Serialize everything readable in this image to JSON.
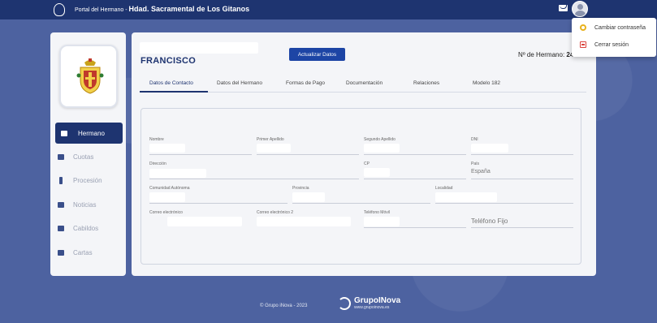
{
  "header": {
    "title_prefix": "Portal del Hermano - ",
    "title_main": "Hdad. Sacramental de Los Gitanos"
  },
  "user_menu": {
    "items": [
      {
        "label": "Cambiar contraseña",
        "icon": "gear-icon"
      },
      {
        "label": "Cerrar sesión",
        "icon": "logout-icon"
      }
    ]
  },
  "sidebar": {
    "items": [
      {
        "label": "Hermano",
        "icon": "person-icon",
        "active": true
      },
      {
        "label": "Cuotas",
        "icon": "coins-icon"
      },
      {
        "label": "Procesión",
        "icon": "cross-icon"
      },
      {
        "label": "Noticias",
        "icon": "newspaper-icon"
      },
      {
        "label": "Cabildos",
        "icon": "people-icon"
      },
      {
        "label": "Cartas",
        "icon": "letter-icon"
      }
    ]
  },
  "profile": {
    "name": "FRANCISCO",
    "update_button": "Actualizar Datos",
    "member_number_label": "Nº de Hermano:",
    "member_number_value": "24"
  },
  "tabs": [
    {
      "label": "Datos de Contacto",
      "active": true
    },
    {
      "label": "Datos del Hermano"
    },
    {
      "label": "Formas de Pago"
    },
    {
      "label": "Documentación"
    },
    {
      "label": "Relaciones"
    },
    {
      "label": "Modelo 182"
    }
  ],
  "form": {
    "nombre": "Nombre",
    "primer_apellido": "Primer Apellido",
    "segundo_apellido": "Segundo Apellido",
    "dni": "DNI",
    "direccion": "Dirección",
    "cp": "CP",
    "pais": "País",
    "pais_value": "España",
    "comunidad": "Comunidad Autónoma",
    "provincia": "Provincia",
    "localidad": "Localidad",
    "correo": "Correo electrónico",
    "correo2": "Correo electrónico 2",
    "telefono_movil": "Teléfono Móvil",
    "telefono_fijo_placeholder": "Teléfono Fijo"
  },
  "footer": {
    "copyright": "© Grupo iNova - 2023",
    "brand": "GrupoINova",
    "url": "www.grupoinova.es"
  }
}
